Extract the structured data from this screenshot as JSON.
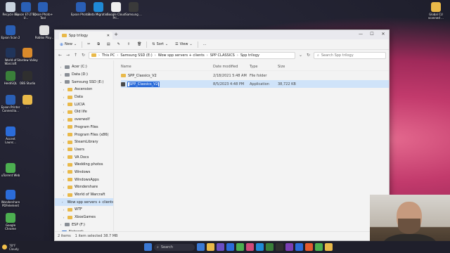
{
  "desktop": {
    "icons": [
      {
        "label": "Recycle Bin",
        "color": "#c9d3df"
      },
      {
        "label": "Epson ET-2720 U...",
        "color": "#2a5fb5"
      },
      {
        "label": "Epson Photo+ Tool",
        "color": "#2a5fb5"
      },
      {
        "label": "Epson Photo+",
        "color": "#2a5fb5"
      },
      {
        "label": "Data Migration",
        "color": "#1f8ad6"
      },
      {
        "label": "Google Cloud Pri...",
        "color": "#eeeeee"
      },
      {
        "label": "Samsung ...",
        "color": "#3a3a3a"
      },
      {
        "label": "Global CU scanned ...",
        "color": "#e9b949"
      },
      {
        "label": "Epson Scan 2",
        "color": "#2a5fb5"
      },
      {
        "label": "Roblox Play...",
        "color": "#e0e0e0"
      },
      {
        "label": "World of Warcraft",
        "color": "#20345a"
      },
      {
        "label": "Stardew Valley",
        "color": "#d98a2b"
      },
      {
        "label": "HeidiSQL",
        "color": "#3a7f3a"
      },
      {
        "label": "OBS Studio",
        "color": "#2f2f2f"
      },
      {
        "label": "Epson Printer Connectio...",
        "color": "#2a5fb5"
      },
      {
        "label": "...",
        "color": "#e9b949"
      },
      {
        "label": "Accent Launc...",
        "color": "#2b6cd9"
      },
      {
        "label": "uTorrent Web",
        "color": "#4caf50"
      },
      {
        "label": "Wondershare PDFelement",
        "color": "#2b6cd9"
      },
      {
        "label": "Google Chrome",
        "color": "#4caf50"
      }
    ]
  },
  "window": {
    "tab_title": "Spp trilogy",
    "toolbar": {
      "new_label": "New",
      "sort_label": "Sort",
      "view_label": "View",
      "more_label": "..."
    },
    "address": {
      "crumbs": [
        "This PC",
        "Samsung SSD (E:)",
        "Wow spp servers + clients",
        "SPP CLASSICS",
        "Spp trilogy"
      ],
      "search_placeholder": "Search Spp trilogy"
    },
    "tree": [
      {
        "label": "Acer (C:)",
        "type": "drive",
        "indent": 1
      },
      {
        "label": "Data (D:)",
        "type": "drive",
        "indent": 1
      },
      {
        "label": "Samsung SSD (E:)",
        "type": "drive",
        "indent": 1,
        "expanded": true
      },
      {
        "label": "Ascension",
        "type": "folder",
        "indent": 2
      },
      {
        "label": "Data",
        "type": "folder",
        "indent": 2
      },
      {
        "label": "LUCIA",
        "type": "folder",
        "indent": 2
      },
      {
        "label": "Old life",
        "type": "folder",
        "indent": 2
      },
      {
        "label": "overwolf",
        "type": "folder",
        "indent": 2
      },
      {
        "label": "Program Files",
        "type": "folder",
        "indent": 2
      },
      {
        "label": "Program Files (x86)",
        "type": "folder",
        "indent": 2
      },
      {
        "label": "SteamLibrary",
        "type": "folder",
        "indent": 2
      },
      {
        "label": "Users",
        "type": "folder",
        "indent": 2
      },
      {
        "label": "VA Docs",
        "type": "folder",
        "indent": 2
      },
      {
        "label": "Wedding photos",
        "type": "folder",
        "indent": 2
      },
      {
        "label": "Windows",
        "type": "folder",
        "indent": 2
      },
      {
        "label": "WindowsApps",
        "type": "folder",
        "indent": 2
      },
      {
        "label": "Wondershare",
        "type": "folder",
        "indent": 2
      },
      {
        "label": "World of Warcraft",
        "type": "folder",
        "indent": 2
      },
      {
        "label": "Wow spp servers + clients",
        "type": "folder",
        "indent": 2,
        "selected": true
      },
      {
        "label": "WTF",
        "type": "folder",
        "indent": 2
      },
      {
        "label": "XboxGames",
        "type": "folder",
        "indent": 2
      },
      {
        "label": "ESP (F:)",
        "type": "drive",
        "indent": 1
      },
      {
        "label": "Network",
        "type": "network",
        "indent": 0
      }
    ],
    "columns": [
      "Name",
      "Date modified",
      "Type",
      "Size"
    ],
    "files": [
      {
        "name": "SPP_Classics_V2",
        "date": "2/18/2021 5:48 AM",
        "type": "File folder",
        "size": "",
        "kind": "folder"
      },
      {
        "name": "SPP_Classics_V2",
        "date": "8/5/2023 4:48 PM",
        "type": "Application",
        "size": "38,722 KB",
        "kind": "app",
        "renaming": true
      }
    ],
    "status": {
      "items": "2 items",
      "selected": "1 item selected  38.7 MB"
    }
  },
  "taskbar": {
    "weather_temp": "78°F",
    "weather_desc": "Cloudy",
    "search_label": "Search",
    "apps": [
      "#3b79d4",
      "#e9b949",
      "#6a4fc4",
      "#2b6cd9",
      "#4caf50",
      "#d04a7a",
      "#1f8ad6",
      "#3a7f3a",
      "#2f2f2f",
      "#7b3fb5",
      "#2b6cd9",
      "#e35b2f",
      "#4caf50",
      "#e9b949"
    ]
  }
}
